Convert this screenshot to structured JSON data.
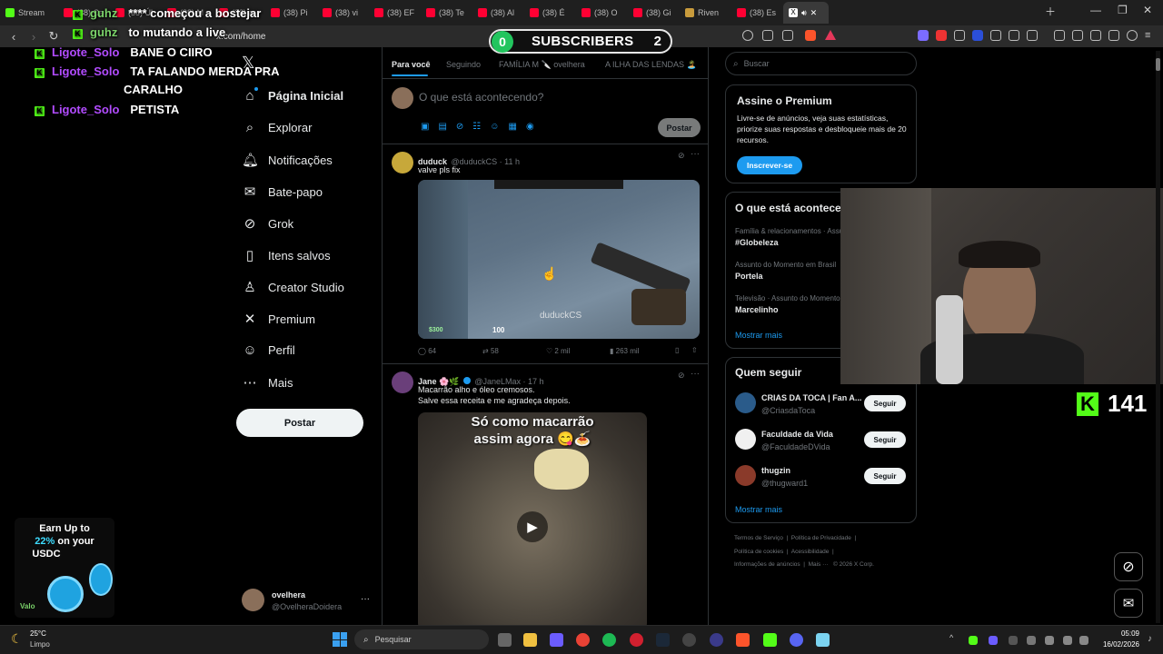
{
  "browser": {
    "tabs": [
      {
        "label": "Stream"
      },
      {
        "label": "(38) Ca"
      },
      {
        "label": "(38) Úl"
      },
      {
        "label": "(38) M"
      },
      {
        "label": "(38) a"
      },
      {
        "label": "(38) Pi"
      },
      {
        "label": "(38) vi"
      },
      {
        "label": "(38) EF"
      },
      {
        "label": "(38) Te"
      },
      {
        "label": "(38) Al"
      },
      {
        "label": "(38) É"
      },
      {
        "label": "(38) O"
      },
      {
        "label": "(38) Gi"
      },
      {
        "label": "Riven"
      },
      {
        "label": "(38) Es"
      }
    ],
    "url": "x.com/home"
  },
  "overlay": {
    "subscribers_label": "SUBSCRIBERS",
    "subscribers_left": "0",
    "subscribers_right": "2",
    "kick_count": "141",
    "chat": [
      {
        "user": "guhz",
        "text": "**** começou a bostejar"
      },
      {
        "user": "guhz",
        "text": "to mutando a live"
      },
      {
        "user": "Ligote_Solo",
        "text": "BANE O CIIRO"
      },
      {
        "user": "Ligote_Solo",
        "text": "TA FALANDO MERDA PRA"
      },
      {
        "user": "",
        "text": "CARALHO"
      },
      {
        "user": "Ligote_Solo",
        "text": "PETISTA"
      }
    ],
    "ad": {
      "line1": "Earn Up to",
      "percent": "22%",
      "line2": "on your",
      "line3": "USDC",
      "brand": "Valo"
    }
  },
  "sidebar": {
    "logo": "𝕏",
    "items": [
      {
        "label": "Página Inicial",
        "icon": "home-icon"
      },
      {
        "label": "Explorar",
        "icon": "search-icon"
      },
      {
        "label": "Notificações",
        "icon": "bell-icon"
      },
      {
        "label": "Bate-papo",
        "icon": "mail-icon"
      },
      {
        "label": "Grok",
        "icon": "grok-icon"
      },
      {
        "label": "Itens salvos",
        "icon": "bookmark-icon"
      },
      {
        "label": "Creator Studio",
        "icon": "creator-icon"
      },
      {
        "label": "Premium",
        "icon": "x-icon"
      },
      {
        "label": "Perfil",
        "icon": "person-icon"
      },
      {
        "label": "Mais",
        "icon": "more-icon"
      }
    ],
    "post_label": "Postar",
    "account": {
      "name": "ovelhera",
      "handle": "@OvelheraDoidera"
    }
  },
  "feed": {
    "tabs": [
      "Para você",
      "Seguindo",
      "FAMÍLIA M 🔪 ovelhera",
      "A ILHA DAS LENDAS 🏝️"
    ],
    "compose_placeholder": "O que está acontecendo?",
    "compose_post": "Postar",
    "tweets": [
      {
        "name": "duduck",
        "handle": "@duduckCS · 11 h",
        "text": "valve pls fix",
        "media_watermark": "duduckCS",
        "hud_money": "$300",
        "hud_hp": "100",
        "stats": {
          "replies": "64",
          "retweets": "58",
          "likes": "2 mil",
          "views": "263 mil"
        }
      },
      {
        "name": "Jane 🌸🌿",
        "handle": "@JaneLMax · 17 h",
        "text1": "Macarrão alho e óleo cremosos.",
        "text2": "Salve essa receita e me agradeça depois.",
        "video_caption1": "Só como macarrão",
        "video_caption2": "assim agora 😋🍝"
      }
    ]
  },
  "right": {
    "search_placeholder": "Buscar",
    "premium": {
      "title": "Assine o Premium",
      "body": "Livre-se de anúncios, veja suas estatísticas, priorize suas respostas e desbloqueie mais de 20 recursos.",
      "button": "Inscrever-se"
    },
    "trends": {
      "title": "O que está acontece",
      "items": [
        {
          "meta": "Família & relacionamentos · Assu",
          "topic": "#Globeleza"
        },
        {
          "meta": "Assunto do Momento em Brasil",
          "topic": "Portela"
        },
        {
          "meta": "Televisão · Assunto do Momento",
          "topic": "Marcelinho"
        }
      ],
      "more": "Mostrar mais"
    },
    "who_to_follow": {
      "title": "Quem seguir",
      "items": [
        {
          "name": "CRIAS DA TOCA | Fan A...",
          "handle": "@CriasdaToca",
          "button": "Seguir"
        },
        {
          "name": "Faculdade da Vida",
          "handle": "@FaculdadeDVida",
          "button": "Seguir"
        },
        {
          "name": "thugzin",
          "handle": "@thugward1",
          "button": "Seguir"
        }
      ],
      "more": "Mostrar mais"
    },
    "footer": [
      "Termos de Serviço",
      "Política de Privacidade",
      "Política de cookies",
      "Acessibilidade",
      "Informações de anúncios",
      "Mais ···",
      "© 2026 X Corp."
    ]
  },
  "taskbar": {
    "weather_temp": "25°C",
    "weather_desc": "Limpo",
    "search_placeholder": "Pesquisar",
    "time": "05:09",
    "date": "16/02/2026"
  }
}
